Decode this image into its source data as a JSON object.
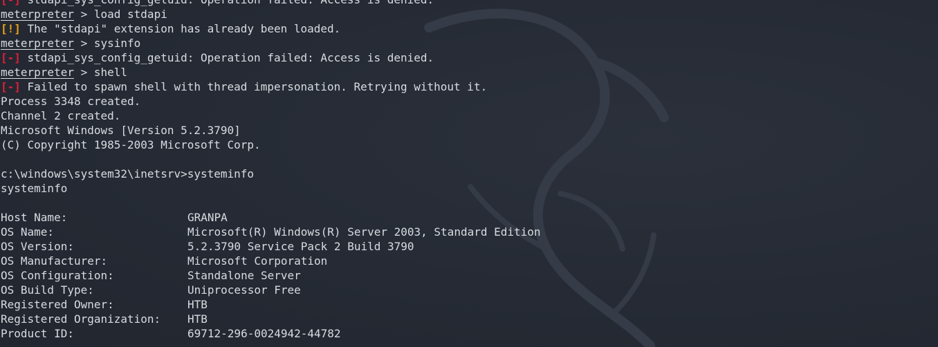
{
  "watermark": {
    "icon": "kali-dragon-icon",
    "color": "#3a404b"
  },
  "colors": {
    "background": "#252a34",
    "text": "#d8dce2",
    "error": "#e0203a",
    "warning": "#e8a317"
  },
  "lines": [
    {
      "type": "error",
      "tag": "[-]",
      "text": " stdapi_sys_config_getuid: Operation failed: Access is denied."
    },
    {
      "type": "prompt",
      "prompt": "meterpreter",
      "cmd": " > load stdapi"
    },
    {
      "type": "warn",
      "tag": "[!]",
      "text": " The \"stdapi\" extension has already been loaded."
    },
    {
      "type": "prompt",
      "prompt": "meterpreter",
      "cmd": " > sysinfo"
    },
    {
      "type": "error",
      "tag": "[-]",
      "text": " stdapi_sys_config_getuid: Operation failed: Access is denied."
    },
    {
      "type": "prompt",
      "prompt": "meterpreter",
      "cmd": " > shell"
    },
    {
      "type": "error",
      "tag": "[-]",
      "text": " Failed to spawn shell with thread impersonation. Retrying without it."
    },
    {
      "type": "plain",
      "text": "Process 3348 created."
    },
    {
      "type": "plain",
      "text": "Channel 2 created."
    },
    {
      "type": "plain",
      "text": "Microsoft Windows [Version 5.2.3790]"
    },
    {
      "type": "plain",
      "text": "(C) Copyright 1985-2003 Microsoft Corp."
    },
    {
      "type": "plain",
      "text": ""
    },
    {
      "type": "plain",
      "text": "c:\\windows\\system32\\inetsrv>systeminfo"
    },
    {
      "type": "plain",
      "text": "systeminfo"
    },
    {
      "type": "plain",
      "text": ""
    },
    {
      "type": "info",
      "key": "Host Name:",
      "value": "GRANPA"
    },
    {
      "type": "info",
      "key": "OS Name:",
      "value": "Microsoft(R) Windows(R) Server 2003, Standard Edition"
    },
    {
      "type": "info",
      "key": "OS Version:",
      "value": "5.2.3790 Service Pack 2 Build 3790"
    },
    {
      "type": "info",
      "key": "OS Manufacturer:",
      "value": "Microsoft Corporation"
    },
    {
      "type": "info",
      "key": "OS Configuration:",
      "value": "Standalone Server"
    },
    {
      "type": "info",
      "key": "OS Build Type:",
      "value": "Uniprocessor Free"
    },
    {
      "type": "info",
      "key": "Registered Owner:",
      "value": "HTB"
    },
    {
      "type": "info",
      "key": "Registered Organization:",
      "value": "HTB"
    },
    {
      "type": "info",
      "key": "Product ID:",
      "value": "69712-296-0024942-44782"
    }
  ]
}
